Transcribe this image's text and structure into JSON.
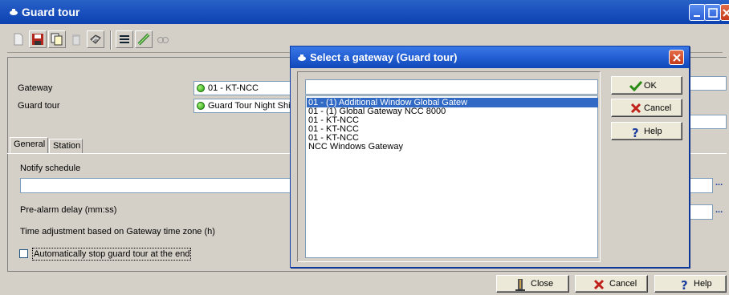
{
  "window": {
    "title": "Guard tour"
  },
  "form": {
    "gateway_label": "Gateway",
    "gateway_value": "01 - KT-NCC",
    "guard_tour_label": "Guard tour",
    "guard_tour_value": "Guard Tour Night Shift #",
    "tabs": [
      {
        "label": "General"
      },
      {
        "label": "Station"
      }
    ],
    "notify_schedule_label": "Notify schedule",
    "pre_alarm_label": "Pre-alarm delay (mm:ss)",
    "time_adjust_label": "Time adjustment based on Gateway time zone (h)",
    "auto_stop_label": "Automatically stop guard tour at the end",
    "browse_ellipsis": "..."
  },
  "bottom_buttons": {
    "close": "Close",
    "cancel": "Cancel",
    "help": "Help"
  },
  "dialog": {
    "title": "Select a gateway (Guard tour)",
    "search_value": "",
    "items": [
      {
        "label": "01 - (1) Additional Window Global Gatew",
        "selected": true
      },
      {
        "label": "01 - (1) Global Gateway NCC 8000",
        "selected": false
      },
      {
        "label": "01 - KT-NCC",
        "selected": false
      },
      {
        "label": "01 - KT-NCC",
        "selected": false
      },
      {
        "label": "01 - KT-NCC",
        "selected": false
      },
      {
        "label": "NCC Windows Gateway",
        "selected": false
      }
    ],
    "ok": "OK",
    "cancel": "Cancel",
    "help": "Help"
  },
  "colors": {
    "title_bar": "#0b42b0",
    "selection": "#316ac5",
    "status_dot": "#22a10e",
    "ok_check": "#2a8a16",
    "cancel_x": "#c0201a"
  },
  "icons": [
    "new-icon",
    "save-icon",
    "copy-icon",
    "delete-icon",
    "print-icon",
    "list-icon",
    "link-icon",
    "find-icon",
    "close-door-icon",
    "x-icon",
    "question-icon",
    "checkmark-icon"
  ]
}
